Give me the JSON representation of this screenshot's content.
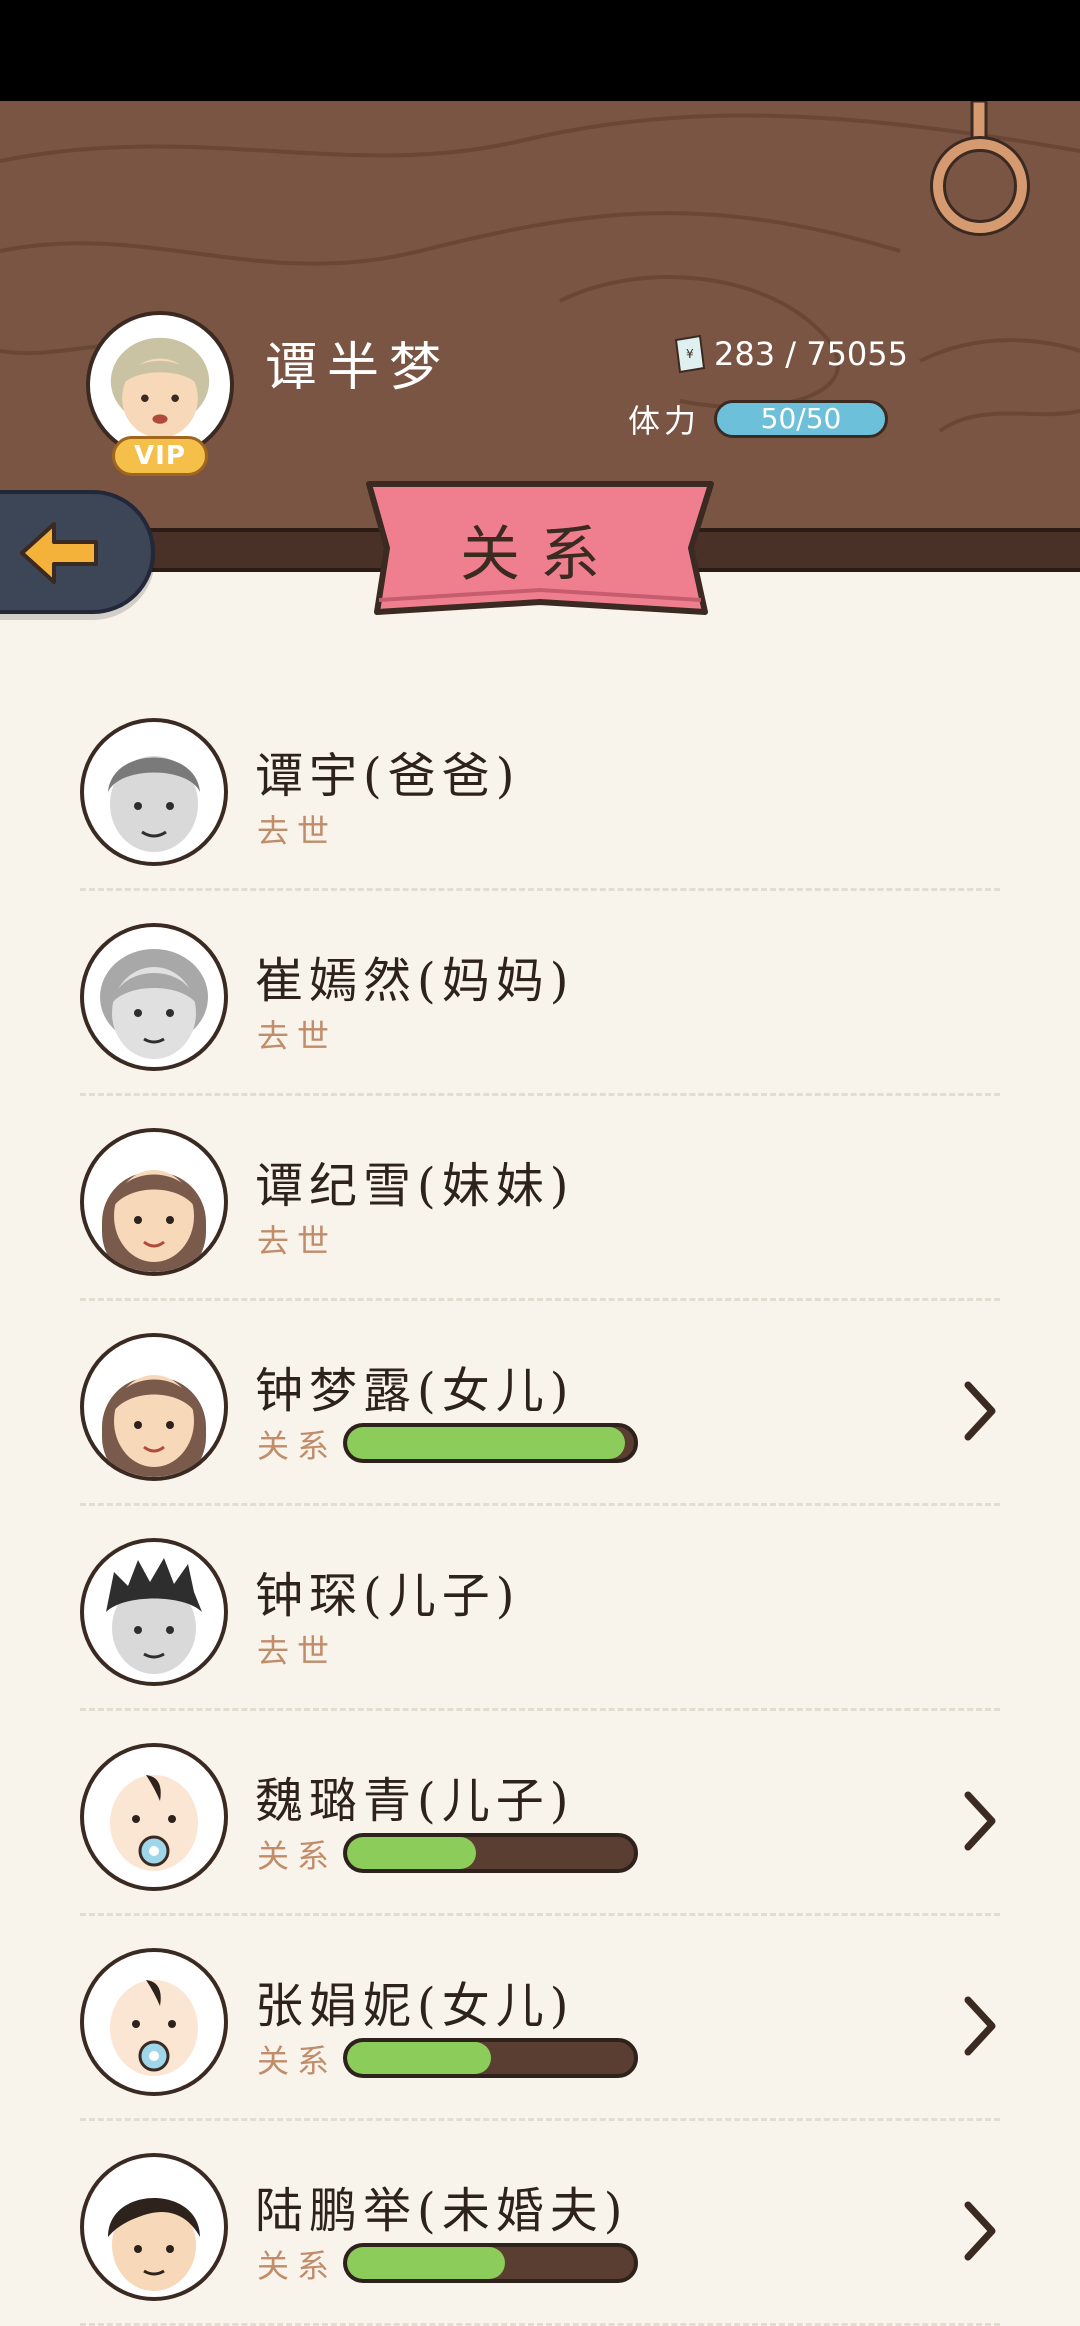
{
  "player": {
    "name": "谭半梦",
    "vip": "VIP",
    "money": "283 / 75055",
    "stamina_label": "体力",
    "stamina_value": "50/50"
  },
  "title": "关系",
  "relations": [
    {
      "name": "谭宇(爸爸)",
      "status": "去世",
      "relation": null,
      "arrow": false,
      "avatar": "old-man-avatar"
    },
    {
      "name": "崔嫣然(妈妈)",
      "status": "去世",
      "relation": null,
      "arrow": false,
      "avatar": "old-woman-avatar"
    },
    {
      "name": "谭纪雪(妹妹)",
      "status": "去世",
      "relation": null,
      "arrow": false,
      "avatar": "woman-avatar"
    },
    {
      "name": "钟梦露(女儿)",
      "status": "关系",
      "relation": 0.97,
      "arrow": true,
      "avatar": "woman-avatar"
    },
    {
      "name": "钟琛(儿子)",
      "status": "去世",
      "relation": null,
      "arrow": false,
      "avatar": "man-avatar"
    },
    {
      "name": "魏璐青(儿子)",
      "status": "关系",
      "relation": 0.45,
      "arrow": true,
      "avatar": "baby-avatar"
    },
    {
      "name": "张娟妮(女儿)",
      "status": "关系",
      "relation": 0.5,
      "arrow": true,
      "avatar": "baby-avatar"
    },
    {
      "name": "陆鹏举(未婚夫)",
      "status": "关系",
      "relation": 0.55,
      "arrow": true,
      "avatar": "young-man-avatar"
    }
  ],
  "colors": {
    "header_wood": "#7a5543",
    "banner_pink": "#ef7f8f",
    "bar_green": "#8ccc5a",
    "stamina_blue": "#6cc0da"
  }
}
